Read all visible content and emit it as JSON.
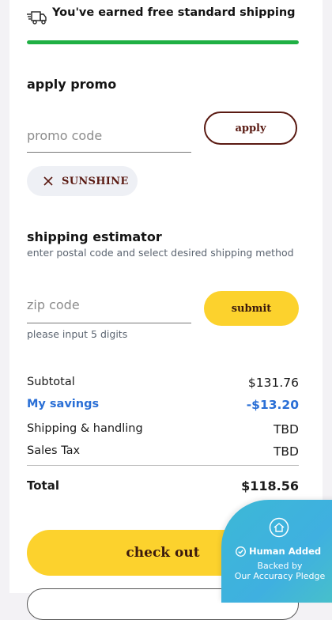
{
  "shipping_banner": {
    "text": "You've earned free standard shipping",
    "progress_percent": 100,
    "progress_color": "#1fb044"
  },
  "promo": {
    "heading": "apply promo",
    "input_placeholder": "promo code",
    "apply_label": "apply",
    "applied_code": "SUNSHINE"
  },
  "shipping_estimator": {
    "heading": "shipping estimator",
    "subtitle": "enter postal code and select desired shipping method",
    "zip_placeholder": "zip code",
    "submit_label": "submit",
    "hint": "please input 5 digits"
  },
  "summary": {
    "subtotal_label": "Subtotal",
    "subtotal_value": "$131.76",
    "savings_label": "My savings",
    "savings_value": "-$13.20",
    "shipping_label": "Shipping & handling",
    "shipping_value": "TBD",
    "tax_label": "Sales Tax",
    "tax_value": "TBD",
    "total_label": "Total",
    "total_value": "$118.56"
  },
  "checkout": {
    "label": "check out"
  },
  "accuracy_badge": {
    "title": "Human Added",
    "line1": "Backed by",
    "line2": "Our Accuracy Pledge"
  },
  "colors": {
    "accent_yellow": "#fcd22d",
    "brand_brown": "#5a1a12",
    "savings_blue": "#2a6fd6",
    "badge_blue": "#3fb0e0"
  }
}
